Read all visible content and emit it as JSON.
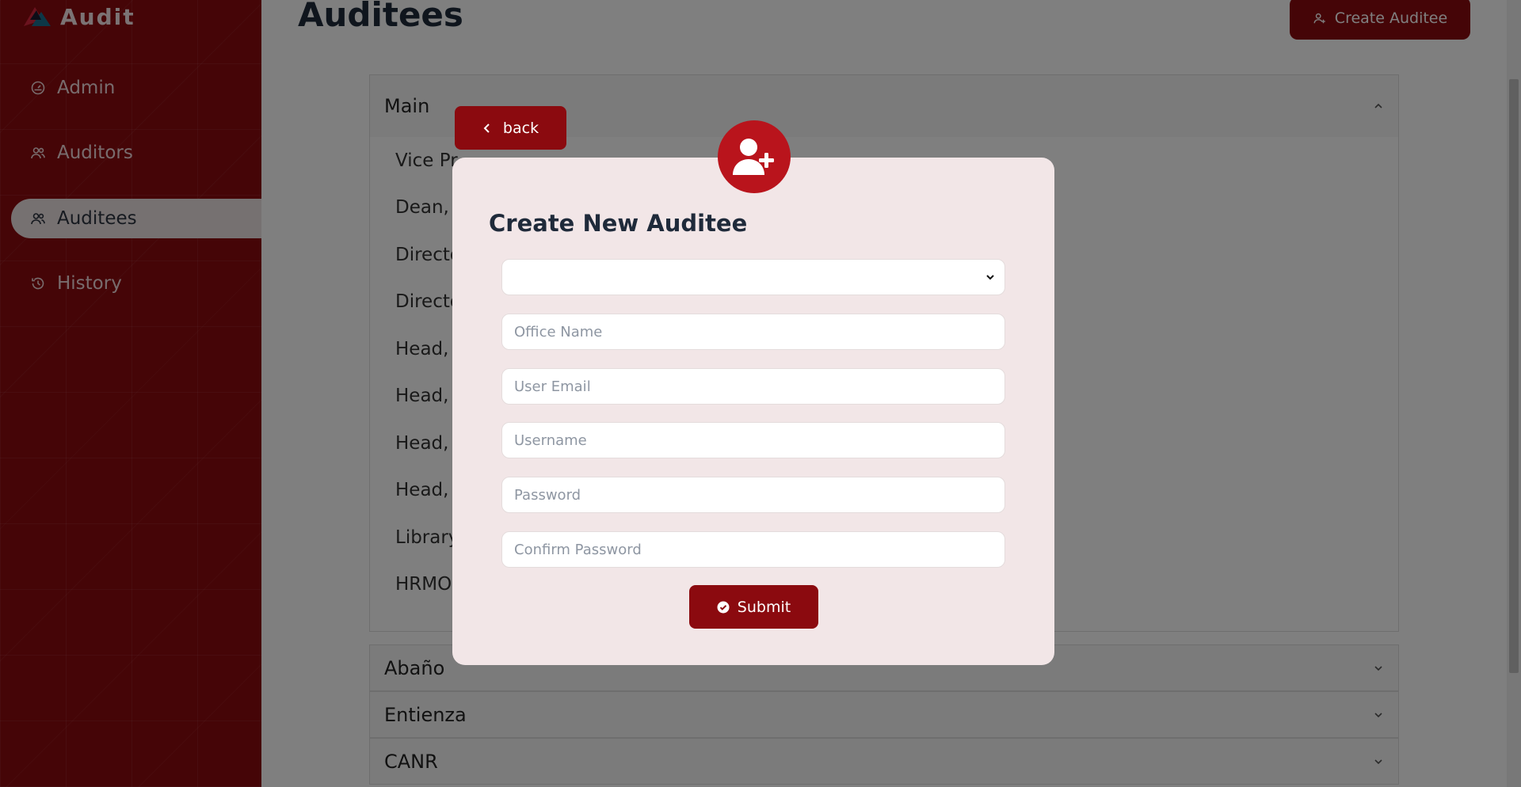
{
  "app": {
    "name": "Audit"
  },
  "sidebar": {
    "items": [
      {
        "label": "Admin",
        "icon": "gauge-icon"
      },
      {
        "label": "Auditors",
        "icon": "users-icon"
      },
      {
        "label": "Auditees",
        "icon": "users-icon",
        "active": true
      },
      {
        "label": "History",
        "icon": "history-icon"
      }
    ]
  },
  "header": {
    "title": "Auditees",
    "create_label": "Create Auditee"
  },
  "accordion": {
    "main": {
      "title": "Main",
      "rows": [
        "Vice Pr",
        "Dean, C",
        "Directo",
        "Directo",
        "Head, S",
        "Head, C",
        "Head, I",
        "Head, I",
        "Library",
        "HRMO"
      ]
    },
    "collapsed": [
      "Abaño",
      "Entienza",
      "CANR"
    ]
  },
  "modal": {
    "back_label": "back",
    "title": "Create New Auditee",
    "select_value": "",
    "office_name_placeholder": "Office Name",
    "user_email_placeholder": "User Email",
    "username_placeholder": "Username",
    "password_placeholder": "Password",
    "confirm_password_placeholder": "Confirm Password",
    "submit_label": "Submit"
  },
  "colors": {
    "brand": "#8b0a0f",
    "accent": "#b9141c",
    "modal_bg": "#f2e6e7"
  }
}
